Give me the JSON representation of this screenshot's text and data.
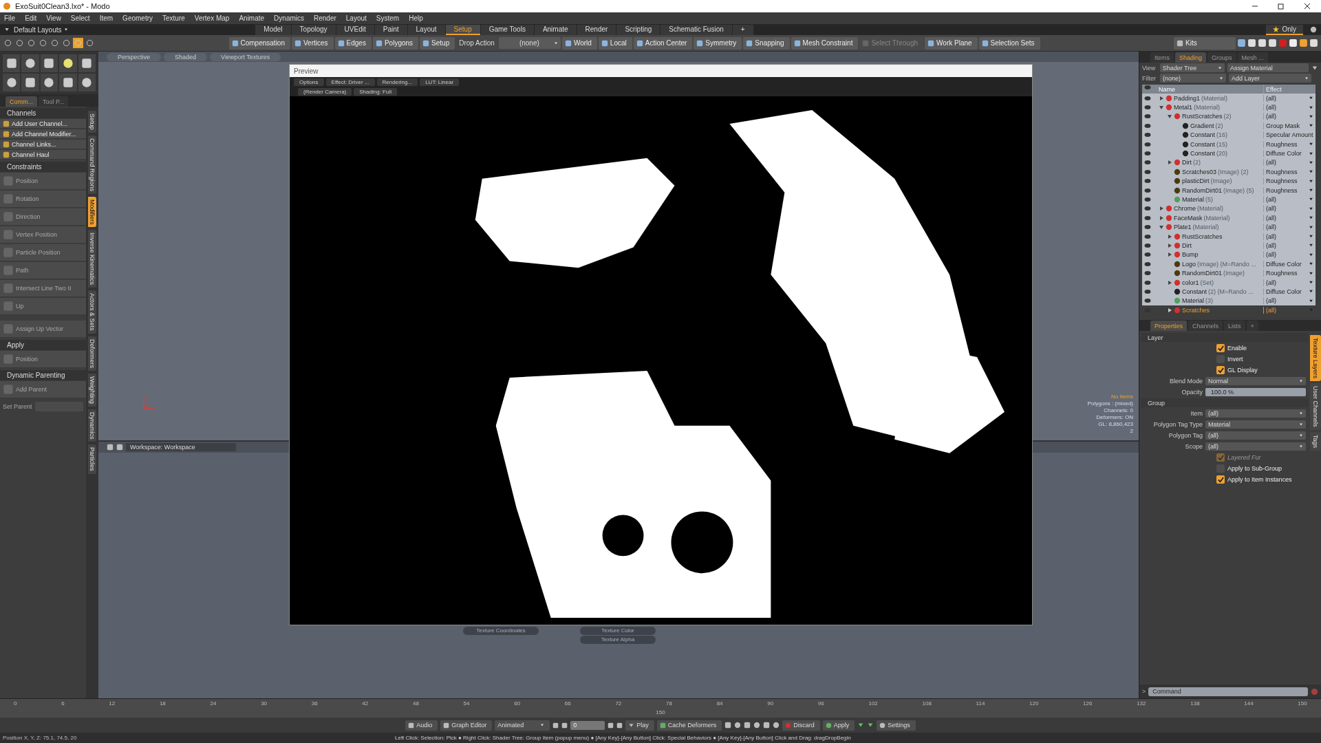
{
  "window": {
    "title": "ExoSuit0Clean3.lxo* - Modo"
  },
  "menu": [
    "File",
    "Edit",
    "View",
    "Select",
    "Item",
    "Geometry",
    "Texture",
    "Vertex Map",
    "Animate",
    "Dynamics",
    "Render",
    "Layout",
    "System",
    "Help"
  ],
  "layouts": {
    "current": "Default Layouts",
    "favorite": "Only",
    "tabs": [
      {
        "label": "Model",
        "selected": false
      },
      {
        "label": "Topology",
        "selected": false
      },
      {
        "label": "UVEdit",
        "selected": false
      },
      {
        "label": "Paint",
        "selected": false
      },
      {
        "label": "Layout",
        "selected": false
      },
      {
        "label": "Setup",
        "selected": true
      },
      {
        "label": "Game Tools",
        "selected": false
      },
      {
        "label": "Animate",
        "selected": false
      },
      {
        "label": "Render",
        "selected": false
      },
      {
        "label": "Scripting",
        "selected": false
      },
      {
        "label": "Schematic Fusion",
        "selected": false
      },
      {
        "label": "+",
        "selected": false
      }
    ]
  },
  "toolbar": {
    "left": [
      {
        "kind": "button",
        "label": "Compensation",
        "disabled": false
      },
      {
        "kind": "button",
        "label": "Vertices",
        "disabled": false
      },
      {
        "kind": "button",
        "label": "Edges",
        "disabled": false
      },
      {
        "kind": "button",
        "label": "Polygons",
        "disabled": false
      },
      {
        "kind": "button",
        "label": "Setup",
        "disabled": false
      },
      {
        "kind": "label",
        "label": "Drop Action"
      },
      {
        "kind": "dropdown",
        "label": "(none)"
      },
      {
        "kind": "button",
        "label": "World",
        "disabled": false
      },
      {
        "kind": "button",
        "label": "Local",
        "disabled": false
      },
      {
        "kind": "button",
        "label": "Action Center",
        "disabled": false
      },
      {
        "kind": "button",
        "label": "Symmetry",
        "disabled": false
      },
      {
        "kind": "button",
        "label": "Snapping",
        "disabled": false
      },
      {
        "kind": "button",
        "label": "Mesh Constraint",
        "disabled": false
      },
      {
        "kind": "button",
        "label": "Select Through",
        "disabled": true
      },
      {
        "kind": "button",
        "label": "Work Plane",
        "disabled": false
      },
      {
        "kind": "button",
        "label": "Selection Sets",
        "disabled": false
      }
    ],
    "right": [
      {
        "label": "Kits",
        "disabled": false
      }
    ]
  },
  "left_panel": {
    "tabs": [
      {
        "label": "Comm...",
        "selected": true
      },
      {
        "label": "Tool P...",
        "selected": false
      }
    ],
    "sections": [
      {
        "title": "Channels",
        "items": [
          {
            "label": "Add User Channel...",
            "disabled": false
          },
          {
            "label": "Add Channel Modifier...",
            "disabled": false
          },
          {
            "label": "Channel Links...",
            "disabled": false
          },
          {
            "label": "Channel Haul",
            "disabled": false
          }
        ]
      },
      {
        "title": "Constraints",
        "items": [
          {
            "label": "Position",
            "disabled": true
          },
          {
            "label": "Rotation",
            "disabled": true
          },
          {
            "label": "Direction",
            "disabled": true
          },
          {
            "label": "Vertex Position",
            "disabled": true
          },
          {
            "label": "Particle Position",
            "disabled": true
          },
          {
            "label": "Path",
            "disabled": true
          },
          {
            "label": "Intersect Line Two II",
            "disabled": true
          },
          {
            "label": "Up",
            "disabled": true
          }
        ]
      },
      {
        "items": [
          {
            "label": "Assign Up Vector",
            "disabled": true
          }
        ]
      },
      {
        "title": "Apply",
        "items": [
          {
            "label": "Position",
            "disabled": true
          }
        ]
      },
      {
        "title": "Dynamic Parenting",
        "items": [
          {
            "label": "Add Parent",
            "disabled": true
          }
        ]
      }
    ],
    "set_parent": "Set Parent",
    "side_tabs": [
      {
        "label": "Setup",
        "selected": false
      },
      {
        "label": "Command Regions",
        "selected": false
      },
      {
        "label": "Modifiers",
        "selected": true
      },
      {
        "label": "Inverse Kinematics",
        "selected": false
      },
      {
        "label": "Actors & Sets",
        "selected": false
      },
      {
        "label": "Deformers",
        "selected": false
      },
      {
        "label": "Weighting",
        "selected": false
      },
      {
        "label": "Dynamics",
        "selected": false
      },
      {
        "label": "Particles",
        "selected": false
      }
    ]
  },
  "viewport": {
    "buttons": [
      "Perspective",
      "Shaded",
      "Viewport Textures"
    ],
    "info": [
      "No Items",
      "Polygons : (mixed)",
      "Channels: 0",
      "Deformers: ON",
      "GL: 8,860,423",
      "2"
    ]
  },
  "preview": {
    "title": "Preview",
    "row_1": [
      "Options",
      "Effect: Driver ...",
      "Rendering...",
      "LUT: Linear"
    ],
    "row_2": [
      "(Render Camera)",
      "Shading: Full"
    ]
  },
  "schematic": {
    "title": "Workspace: Workspace",
    "nodes": [
      "Texture Coordinates",
      "Texture Color",
      "Texture Alpha"
    ]
  },
  "shader_panel": {
    "tabs": [
      {
        "label": "Items",
        "selected": false
      },
      {
        "label": "Shading",
        "selected": true
      },
      {
        "label": "Groups",
        "selected": false
      },
      {
        "label": "Mesh ...",
        "selected": false
      }
    ],
    "view_label": "View",
    "view": "Shader Tree",
    "assign": "Assign Material",
    "filter_label": "Filter",
    "filter": "(none)",
    "add_layer": "Add Layer",
    "columns": [
      "Name",
      "Effect"
    ]
  },
  "shader_tree": [
    {
      "kind": "group",
      "name": "Padding1",
      "note": "(Material)",
      "effect": "(all)",
      "expanded": false,
      "selected": false
    },
    {
      "kind": "group",
      "name": "Metal1",
      "note": "(Material)",
      "effect": "(all)",
      "expanded": true,
      "selected": false,
      "children": [
        {
          "kind": "group",
          "name": "RustScratches",
          "note": "(2)",
          "effect": "(all)",
          "expanded": true,
          "selected": false,
          "children": [
            {
              "kind": "layer",
              "name": "Gradient",
              "note": "(2)",
              "effect": "Group Mask",
              "selected": false
            },
            {
              "kind": "layer",
              "name": "Constant",
              "note": "(16)",
              "effect": "Specular Amount",
              "selected": false
            },
            {
              "kind": "layer",
              "name": "Constant",
              "note": "(15)",
              "effect": "Roughness",
              "selected": false
            },
            {
              "kind": "layer",
              "name": "Constant",
              "note": "(20)",
              "effect": "Diffuse Color",
              "selected": false
            }
          ]
        },
        {
          "kind": "group",
          "name": "Dirt",
          "note": "(2)",
          "effect": "(all)",
          "expanded": false,
          "selected": false
        },
        {
          "kind": "image",
          "name": "Scratches03",
          "note": "(Image) (2)",
          "effect": "Roughness",
          "selected": false
        },
        {
          "kind": "image",
          "name": "plasticDirt",
          "note": "(Image)",
          "effect": "Roughness",
          "selected": false
        },
        {
          "kind": "image",
          "name": "RandomDirt01",
          "note": "(Image) (5)",
          "effect": "Roughness",
          "selected": false
        },
        {
          "kind": "material",
          "name": "Material",
          "note": "(5)",
          "effect": "(all)",
          "selected": false
        }
      ]
    },
    {
      "kind": "group",
      "name": "Chrome",
      "note": "(Material)",
      "effect": "(all)",
      "expanded": false,
      "selected": false
    },
    {
      "kind": "group",
      "name": "FaceMask",
      "note": "(Material)",
      "effect": "(all)",
      "expanded": false,
      "selected": false
    },
    {
      "kind": "group",
      "name": "Plate1",
      "note": "(Material)",
      "effect": "(all)",
      "expanded": true,
      "selected": false,
      "children": [
        {
          "kind": "group",
          "name": "RustScratches",
          "effect": "(all)",
          "expanded": false,
          "selected": false
        },
        {
          "kind": "group",
          "name": "Dirt",
          "effect": "(all)",
          "expanded": false,
          "selected": false
        },
        {
          "kind": "group",
          "name": "Bump",
          "effect": "(all)",
          "expanded": false,
          "selected": false
        },
        {
          "kind": "image",
          "name": "Logo",
          "note": "(Image) (M=Rando ...",
          "effect": "Diffuse Color",
          "selected": false
        },
        {
          "kind": "image",
          "name": "RandomDirt01",
          "note": "(Image)",
          "effect": "Roughness",
          "selected": false
        },
        {
          "kind": "group",
          "name": "color1",
          "note": "(Set)",
          "effect": "(all)",
          "expanded": false,
          "selected": false
        },
        {
          "kind": "layer",
          "name": "Constant",
          "note": "(2) (M=Rando ...",
          "effect": "Diffuse Color",
          "selected": false
        },
        {
          "kind": "material",
          "name": "Material",
          "note": "(3)",
          "effect": "(all)",
          "selected": false
        },
        {
          "kind": "group",
          "name": "Scratches",
          "effect": "(all)",
          "expanded": false,
          "selected": true
        }
      ]
    }
  ],
  "properties": {
    "tabs": [
      {
        "label": "Properties",
        "selected": true
      },
      {
        "label": "Channels",
        "selected": false
      },
      {
        "label": "Lists",
        "selected": false
      },
      {
        "label": "+",
        "selected": false
      }
    ],
    "sections": [
      {
        "title": "Layer",
        "fields": [
          {
            "kind": "checkbox",
            "label": "Enable",
            "checked": true,
            "disabled": false
          },
          {
            "kind": "checkbox",
            "label": "Invert",
            "checked": false
          },
          {
            "kind": "checkbox",
            "label": "GL Display",
            "checked": true,
            "disabled": false
          },
          {
            "kind": "dropdown",
            "label": "Blend Mode",
            "value": "Normal"
          },
          {
            "kind": "slider",
            "label": "Opacity",
            "value": "100.0 %",
            "level": 1.0
          }
        ]
      },
      {
        "title": "Group",
        "fields": [
          {
            "kind": "dropdown",
            "label": "Item",
            "value": "(all)"
          },
          {
            "kind": "dropdown",
            "label": "Polygon Tag Type",
            "value": "Material"
          },
          {
            "kind": "dropdown",
            "label": "Polygon Tag",
            "value": "(all)"
          },
          {
            "kind": "dropdown",
            "label": "Scope",
            "value": "(all)"
          },
          {
            "kind": "checkbox",
            "label": "Layered Fur",
            "checked": true,
            "disabled": true
          },
          {
            "kind": "checkbox",
            "label": "Apply to Sub-Group",
            "checked": false
          },
          {
            "kind": "checkbox",
            "label": "Apply to Item Instances",
            "checked": true,
            "disabled": false
          }
        ]
      }
    ],
    "side_tabs": [
      {
        "label": "Texture Layers",
        "selected": true
      },
      {
        "label": "User Channels",
        "selected": false
      },
      {
        "label": "Tags",
        "selected": false
      }
    ],
    "command_prompt": ">",
    "command_placeholder": "Command"
  },
  "timeline": {
    "ticks": [
      "0",
      "6",
      "12",
      "18",
      "24",
      "30",
      "36",
      "42",
      "48",
      "54",
      "60",
      "66",
      "72",
      "78",
      "84",
      "90",
      "96",
      "102",
      "108",
      "114",
      "120",
      "126",
      "132",
      "138",
      "144",
      "150"
    ],
    "range_label": "150"
  },
  "bottom_bar": {
    "audio": "Audio",
    "graph_editor": "Graph Editor",
    "mode": "Animated",
    "frame": "0",
    "play": "Play",
    "cache": "Cache Deformers",
    "discard": "Discard",
    "apply": "Apply",
    "settings": "Settings"
  },
  "status_bar": {
    "position": "Position X, Y, Z:  75.1, 74.5, 20",
    "hint": "Left Click: Selection: Pick ● Right Click: Shader Tree: Group Item (popup menu) ● [Any Key]-[Any Button] Click: Special Behaviors ● [Any Key]-[Any Button] Click and Drag: dragDropBegin"
  }
}
